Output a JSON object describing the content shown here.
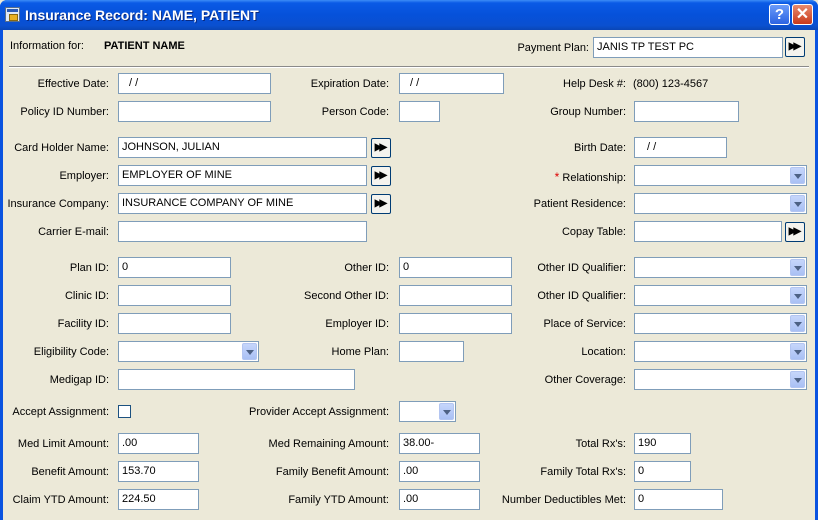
{
  "window": {
    "title": "Insurance Record: NAME, PATIENT",
    "help_label": "?",
    "close_label": "✕"
  },
  "header": {
    "info_label": "Information for:",
    "patient_name": "PATIENT NAME",
    "payment_plan_label": "Payment Plan:",
    "payment_plan_value": "JANIS TP TEST PC"
  },
  "fields": {
    "effective_date": {
      "label": "Effective Date:",
      "value": "/ /"
    },
    "expiration_date": {
      "label": "Expiration Date:",
      "value": "/ /"
    },
    "help_desk": {
      "label": "Help Desk #:",
      "value": "(800) 123-4567"
    },
    "policy_id": {
      "label": "Policy ID Number:",
      "value": ""
    },
    "person_code": {
      "label": "Person Code:",
      "value": ""
    },
    "group_number": {
      "label": "Group Number:",
      "value": ""
    },
    "card_holder": {
      "label": "Card Holder Name:",
      "value": "JOHNSON, JULIAN"
    },
    "birth_date": {
      "label": "Birth Date:",
      "value": "/ /"
    },
    "employer": {
      "label": "Employer:",
      "value": "EMPLOYER OF MINE"
    },
    "relationship": {
      "label": "Relationship:",
      "required_mark": "*",
      "value": ""
    },
    "insurance_company": {
      "label": "Insurance Company:",
      "value": "INSURANCE COMPANY OF MINE"
    },
    "patient_residence": {
      "label": "Patient Residence:",
      "value": ""
    },
    "carrier_email": {
      "label": "Carrier E-mail:",
      "value": ""
    },
    "copay_table": {
      "label": "Copay Table:",
      "value": ""
    },
    "plan_id": {
      "label": "Plan ID:",
      "value": "0"
    },
    "other_id": {
      "label": "Other ID:",
      "value": "0"
    },
    "other_id_qualifier_1": {
      "label": "Other ID Qualifier:",
      "value": ""
    },
    "clinic_id": {
      "label": "Clinic ID:",
      "value": ""
    },
    "second_other_id": {
      "label": "Second Other ID:",
      "value": ""
    },
    "other_id_qualifier_2": {
      "label": "Other ID Qualifier:",
      "value": ""
    },
    "facility_id": {
      "label": "Facility ID:",
      "value": ""
    },
    "employer_id": {
      "label": "Employer ID:",
      "value": ""
    },
    "place_of_service": {
      "label": "Place of Service:",
      "value": ""
    },
    "eligibility_code": {
      "label": "Eligibility Code:",
      "value": ""
    },
    "home_plan": {
      "label": "Home Plan:",
      "value": ""
    },
    "location": {
      "label": "Location:",
      "value": ""
    },
    "medigap_id": {
      "label": "Medigap ID:",
      "value": ""
    },
    "other_coverage": {
      "label": "Other Coverage:",
      "value": ""
    },
    "accept_assignment": {
      "label": "Accept Assignment:"
    },
    "provider_accept_assignment": {
      "label": "Provider Accept Assignment:",
      "value": ""
    },
    "med_limit_amount": {
      "label": "Med Limit Amount:",
      "value": ".00"
    },
    "med_remaining_amount": {
      "label": "Med Remaining Amount:",
      "value": "38.00-"
    },
    "total_rx": {
      "label": "Total Rx's:",
      "value": "190"
    },
    "benefit_amount": {
      "label": "Benefit Amount:",
      "value": "153.70"
    },
    "family_benefit_amount": {
      "label": "Family Benefit Amount:",
      "value": ".00"
    },
    "family_total_rx": {
      "label": "Family Total Rx's:",
      "value": "0"
    },
    "claim_ytd_amount": {
      "label": "Claim YTD Amount:",
      "value": "224.50"
    },
    "family_ytd_amount": {
      "label": "Family YTD Amount:",
      "value": ".00"
    },
    "number_deductibles_met": {
      "label": "Number Deductibles Met:",
      "value": "0"
    }
  },
  "icons": {
    "forward": "fast-forward-icon",
    "dropdown": "chevron-down-icon"
  },
  "colors": {
    "titlebar": "#0a5ae6",
    "window_bg": "#ece9d8",
    "field_border": "#7f9db9",
    "required": "#dd0000"
  }
}
